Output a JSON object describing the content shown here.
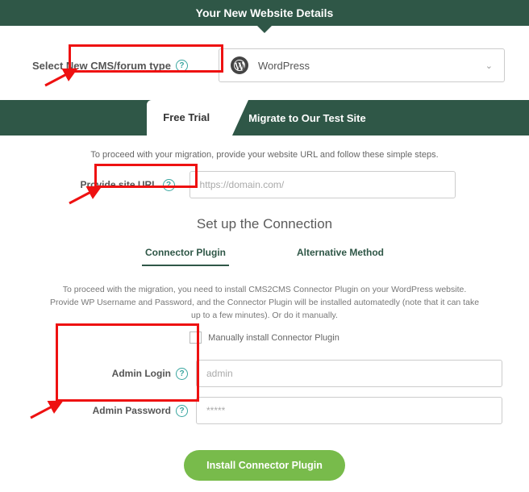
{
  "header": {
    "title": "Your New Website Details"
  },
  "cms": {
    "label": "Select New CMS/forum type",
    "selected": "WordPress"
  },
  "tabs": [
    {
      "label": "Free Trial",
      "active": true
    },
    {
      "label": "Migrate to Our Test Site",
      "active": false
    }
  ],
  "instruction": "To proceed with your migration, provide your website URL and follow these simple steps.",
  "url": {
    "label": "Provide site URL",
    "placeholder": "https://domain.com/",
    "value": ""
  },
  "subheading": "Set up the Connection",
  "method_tabs": [
    {
      "label": "Connector Plugin",
      "active": true
    },
    {
      "label": "Alternative Method",
      "active": false
    }
  ],
  "connector": {
    "description": "To proceed with the migration, you need to install CMS2CMS Connector Plugin on your WordPress website. Provide WP Username and Password, and the Connector Plugin will be installed automatedly (note that it can take up to a few minutes). Or do it manually.",
    "manual_label": "Manually install Connector Plugin",
    "login_label": "Admin Login",
    "login_placeholder": "admin",
    "login_value": "",
    "password_label": "Admin Password",
    "password_placeholder": "*****",
    "password_value": "",
    "button": "Install Connector Plugin"
  }
}
